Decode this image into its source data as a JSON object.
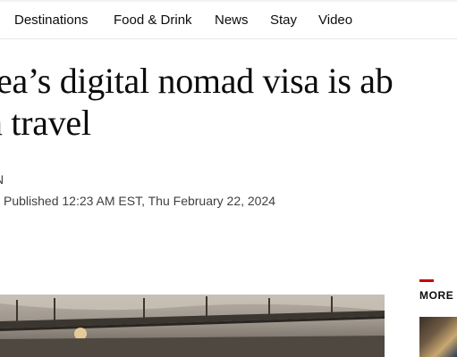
{
  "nav": {
    "items": [
      {
        "label": "Destinations"
      },
      {
        "label": "Food & Drink"
      },
      {
        "label": "News"
      },
      {
        "label": "Stay"
      },
      {
        "label": "Video"
      }
    ]
  },
  "article": {
    "headline_line1": "rea’s digital nomad visa is ab",
    "headline_line2": "n travel",
    "byline": "N",
    "published": "Published 12:23 AM EST, Thu February 22, 2024"
  },
  "sidebar": {
    "more_label": "MORE"
  },
  "colors": {
    "accent_red": "#cc0000",
    "text": "#0c0c0c",
    "muted_text": "#404040"
  }
}
